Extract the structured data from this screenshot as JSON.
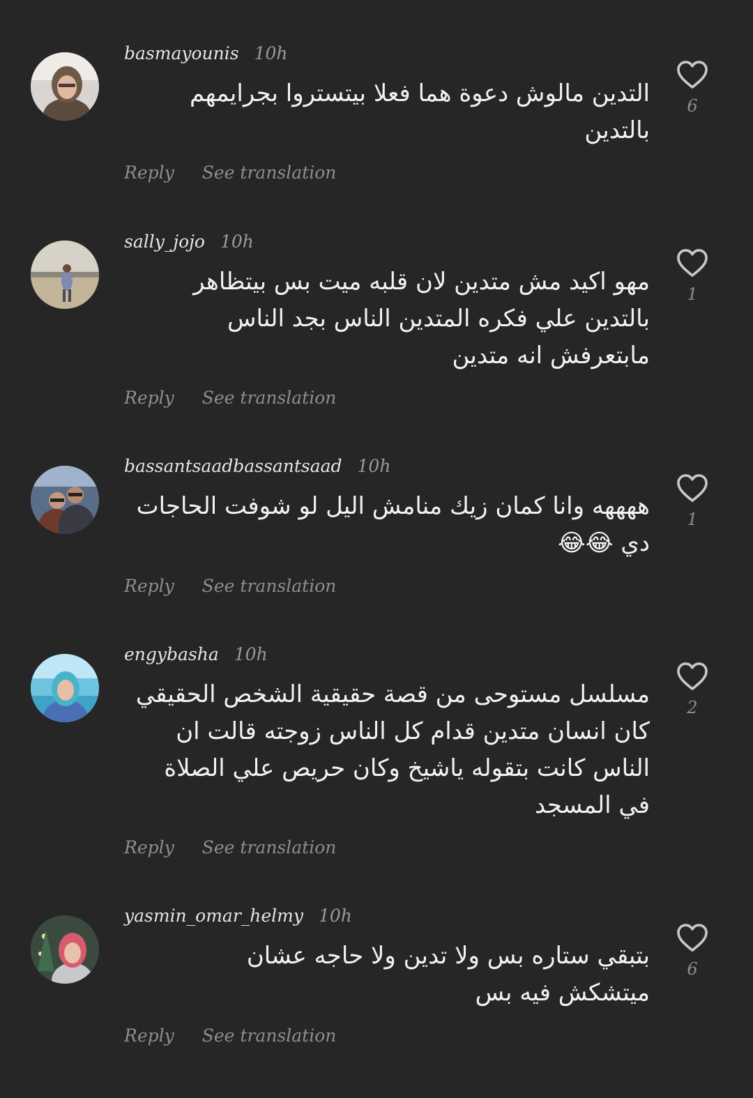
{
  "comments": [
    {
      "username": "basmayounis",
      "time": "10h",
      "text": "التدين مالوش دعوة هما فعلا بيتستروا بجرايمهم\nبالتدين",
      "likes": "6",
      "reply_label": "Reply",
      "translate_label": "See translation"
    },
    {
      "username": "sally_jojo",
      "time": "10h",
      "text": "مهو اكيد مش متدين لان قلبه ميت بس بيتظاهر\nبالتدين علي فكره المتدين الناس بجد الناس\nمابتعرفش انه متدين",
      "likes": "1",
      "reply_label": "Reply",
      "translate_label": "See translation"
    },
    {
      "username": "bassantsaadbassantsaad",
      "time": "10h",
      "text": "ههههه وانا كمان زيك منامش اليل لو شوفت الحاجات\nدي 😂😂",
      "likes": "1",
      "reply_label": "Reply",
      "translate_label": "See translation"
    },
    {
      "username": "engybasha",
      "time": "10h",
      "text": "مسلسل مستوحى من قصة حقيقية الشخص الحقيقي\nكان انسان متدين قدام كل الناس زوجته قالت ان\nالناس كانت بتقوله ياشيخ وكان حريص علي الصلاة\nفي المسجد",
      "likes": "2",
      "reply_label": "Reply",
      "translate_label": "See translation"
    },
    {
      "username": "yasmin_omar_helmy",
      "time": "10h",
      "text": "بتبقي ستاره بس ولا تدين ولا حاجه  عشان\nميتشكش فيه بس",
      "likes": "6",
      "reply_label": "Reply",
      "translate_label": "See translation"
    }
  ],
  "icons": {
    "avatar": "avatar-photo",
    "like": "heart-outline-icon"
  },
  "colors": {
    "background": "#262626",
    "text_primary": "#f2f2f2",
    "text_secondary": "#8e8e8e",
    "icon": "#c8c8c8"
  }
}
